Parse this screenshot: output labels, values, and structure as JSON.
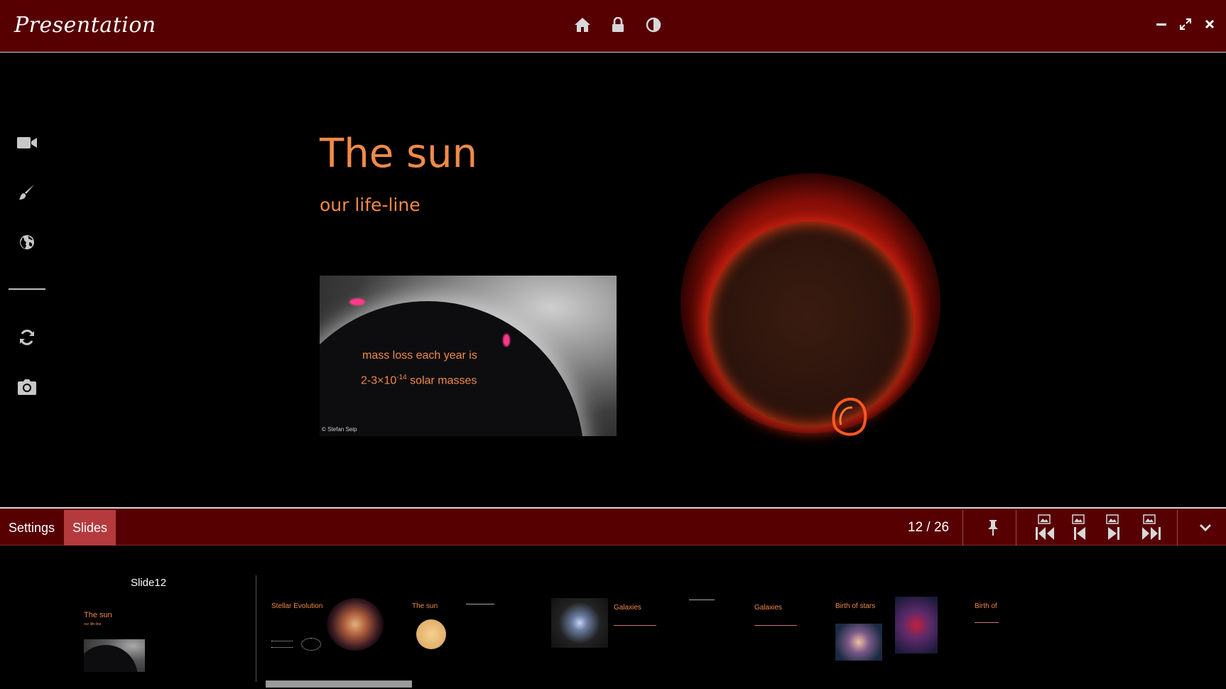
{
  "app": {
    "title": "Presentation"
  },
  "titlebar": {
    "center_icons": [
      "home-icon",
      "lock-icon",
      "contrast-icon"
    ],
    "window_controls": [
      "minimize-icon",
      "maximize-icon",
      "close-icon"
    ]
  },
  "rail": {
    "tools": [
      "video-camera-icon",
      "paintbrush-icon",
      "globe-icon",
      "refresh-icon",
      "camera-icon"
    ]
  },
  "slide": {
    "title": "The sun",
    "subtitle": "our life-line",
    "caption_line1": "mass loss each year is",
    "caption_line2_prefix": "2-3×10",
    "caption_exponent": "-14",
    "caption_line2_suffix": " solar masses",
    "photo_credit": "© Stefan Seip"
  },
  "controlbar": {
    "tabs": [
      {
        "label": "Settings",
        "active": false
      },
      {
        "label": "Slides",
        "active": true
      }
    ],
    "current_slide": "12",
    "separator": "/",
    "total_slides": "26",
    "nav_buttons": [
      "pin-icon",
      "first-slide-icon",
      "previous-slide-icon",
      "next-slide-icon",
      "last-slide-icon",
      "collapse-chevron-icon"
    ]
  },
  "strip": {
    "current_label": "Slide12",
    "current_thumb_title": "The sun",
    "current_thumb_subtitle": "our life-line",
    "thumbnails": [
      {
        "title": "Stellar Evolution"
      },
      {
        "title": "The sun"
      },
      {
        "title": "Galaxies"
      },
      {
        "title": "Galaxies"
      },
      {
        "title": "Birth of stars"
      },
      {
        "title": "Birth of"
      }
    ]
  },
  "colors": {
    "chrome": "#560002",
    "active_tab": "#b53a3e",
    "slide_text": "#f08a48"
  }
}
